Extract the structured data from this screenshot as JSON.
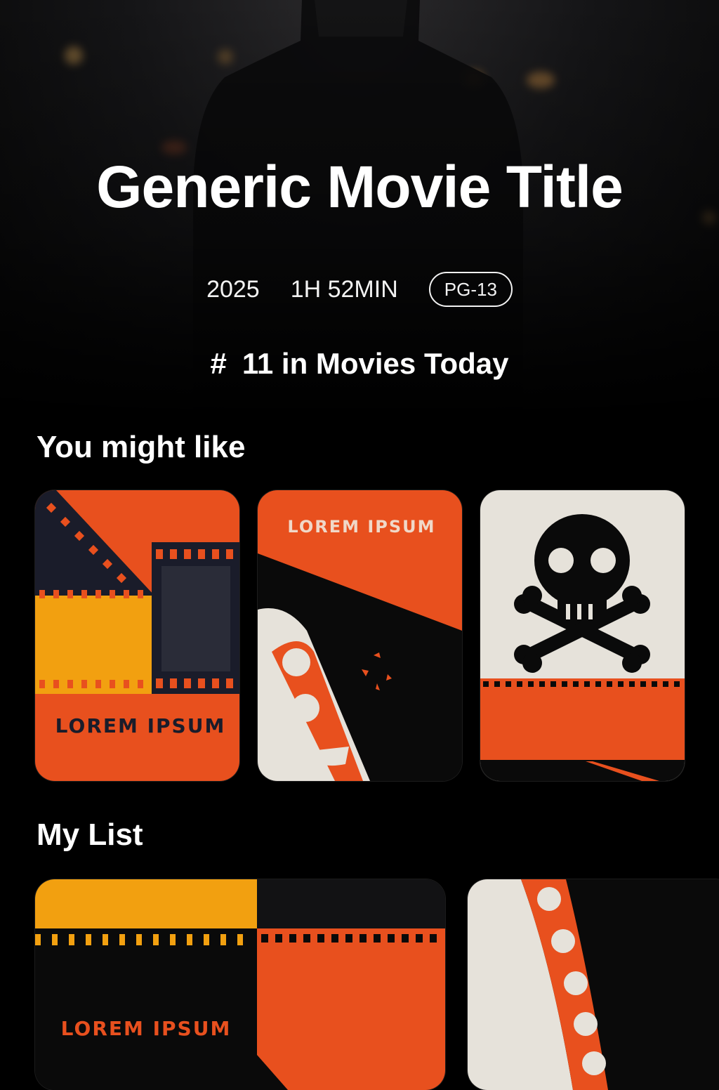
{
  "movie": {
    "title": "Generic Movie Title",
    "year": "2025",
    "duration": "1H 52MIN",
    "rating": "PG-13",
    "rank_icon": "#",
    "rank_text": "11 in Movies Today"
  },
  "sections": {
    "you_might_like": {
      "title": "You might like",
      "posters": [
        {
          "icon": "film-strip",
          "text": "LOREM IPSUM"
        },
        {
          "icon": "film-reel",
          "text": "LOREM IPSUM"
        },
        {
          "icon": "skull-crossbones-icon",
          "text": ""
        }
      ]
    },
    "my_list": {
      "title": "My List",
      "posters": [
        {
          "icon": "film-strip",
          "text": "LOREM IPSUM"
        },
        {
          "icon": "film-reel",
          "text": ""
        }
      ]
    }
  },
  "colors": {
    "accent_orange": "#e8501e",
    "amber": "#f2a010",
    "cream": "#e6e2da",
    "background": "#000000"
  }
}
